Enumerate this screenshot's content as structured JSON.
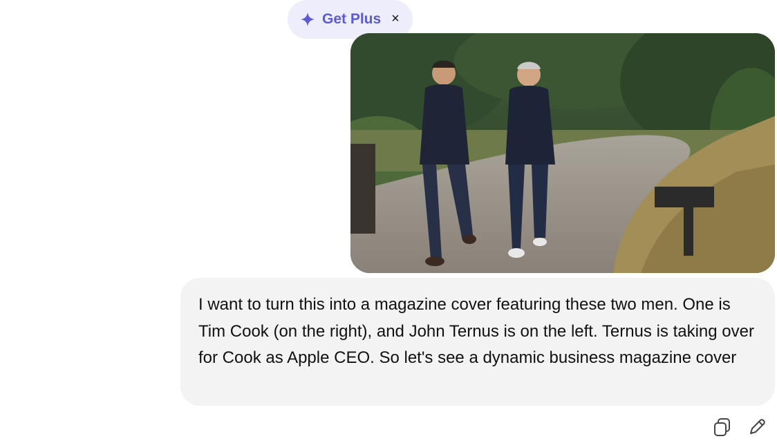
{
  "upgrade_pill": {
    "label": "Get Plus",
    "close_glyph": "×",
    "accent_color": "#5b5bd6",
    "background": "#ededfb",
    "icon": "sparkle-icon"
  },
  "message": {
    "role": "user",
    "attachment": {
      "type": "image",
      "description_icon": "photo"
    },
    "text": "I want to turn this into a magazine cover featuring these two men. One is Tim Cook (on the right), and John Ternus is on the left. Ternus is taking over for Cook as Apple CEO. So let's see a dynamic business magazine cover"
  },
  "message_actions": {
    "copy_icon": "copy-icon",
    "edit_icon": "pencil-icon"
  }
}
